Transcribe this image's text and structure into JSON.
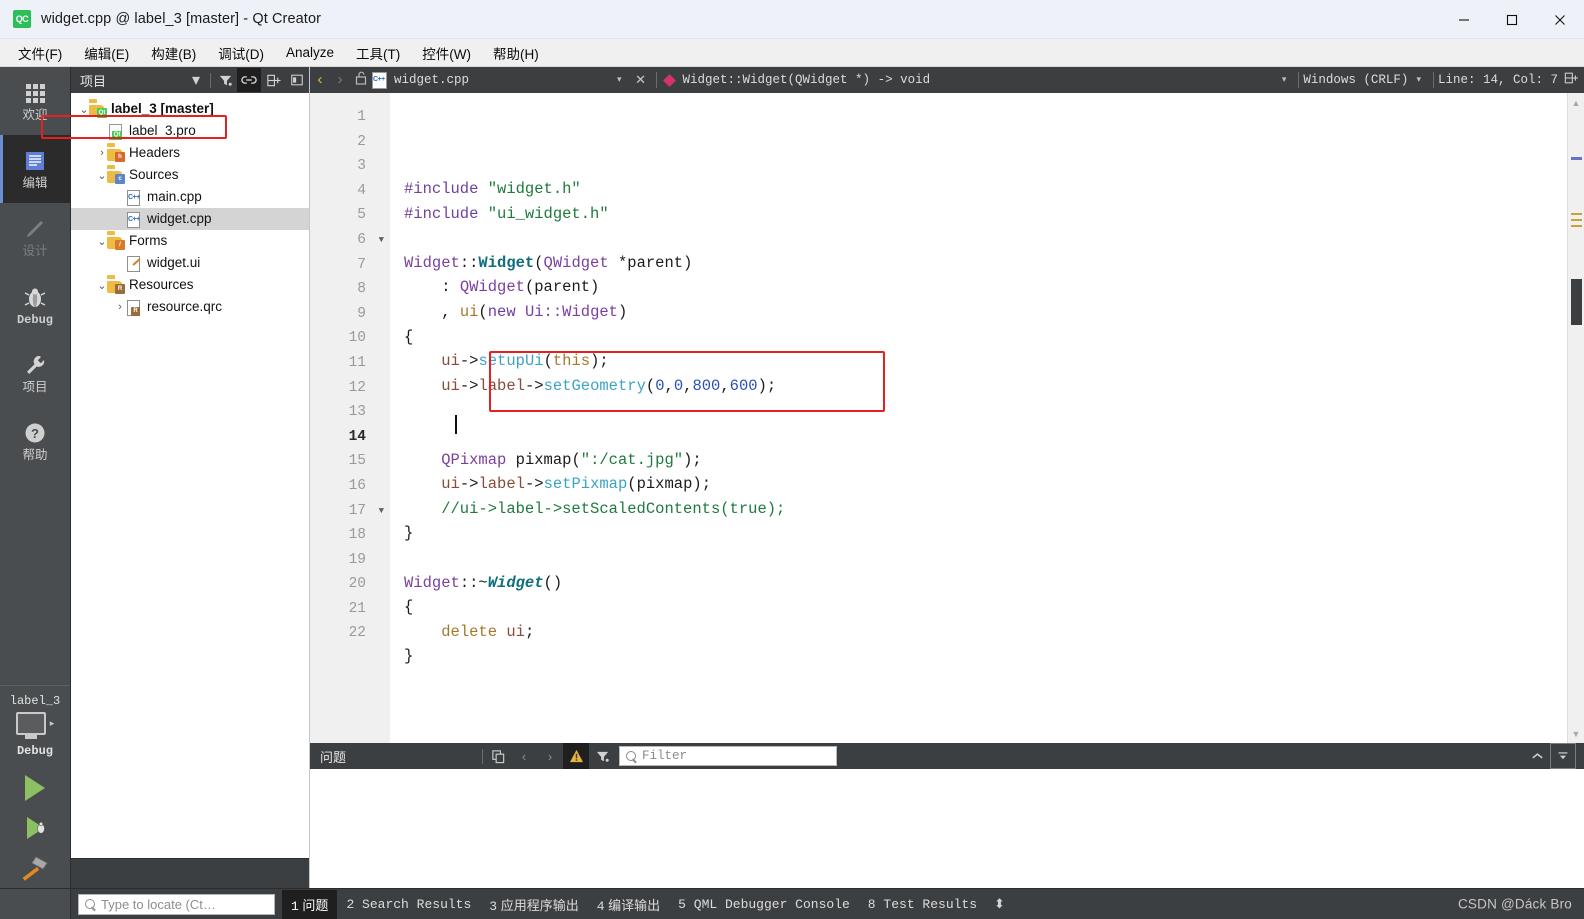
{
  "window": {
    "title": "widget.cpp @ label_3 [master] - Qt Creator",
    "app_icon": "qt-creator-icon",
    "minimize": "─",
    "maximize": "□",
    "close": "✕"
  },
  "menubar": {
    "items": [
      {
        "label": "文件(F)",
        "name": "menu-file"
      },
      {
        "label": "编辑(E)",
        "name": "menu-edit"
      },
      {
        "label": "构建(B)",
        "name": "menu-build"
      },
      {
        "label": "调试(D)",
        "name": "menu-debug"
      },
      {
        "label": "Analyze",
        "name": "menu-analyze"
      },
      {
        "label": "工具(T)",
        "name": "menu-tools"
      },
      {
        "label": "控件(W)",
        "name": "menu-window"
      },
      {
        "label": "帮助(H)",
        "name": "menu-help"
      }
    ]
  },
  "modebar": {
    "modes": [
      {
        "label": "欢迎",
        "icon": "grid-icon",
        "state": "normal"
      },
      {
        "label": "编辑",
        "icon": "document-icon",
        "state": "active"
      },
      {
        "label": "设计",
        "icon": "pencil-icon",
        "state": "disabled"
      },
      {
        "label": "Debug",
        "icon": "bug-icon",
        "state": "normal"
      },
      {
        "label": "项目",
        "icon": "wrench-icon",
        "state": "normal"
      },
      {
        "label": "帮助",
        "icon": "question-icon",
        "state": "normal"
      }
    ],
    "kit": {
      "project": "label_3",
      "build_config": "Debug",
      "selector_icon": "monitor-icon",
      "expand_arrow": "▸"
    },
    "actions": [
      {
        "name": "run-button",
        "icon": "play-icon"
      },
      {
        "name": "debug-button",
        "icon": "play-bug-icon"
      },
      {
        "name": "build-button",
        "icon": "hammer-icon"
      }
    ]
  },
  "project_pane": {
    "header": {
      "title": "项目",
      "dropdown": "▾",
      "buttons": [
        {
          "name": "filter-icon",
          "glyph": "∇"
        },
        {
          "name": "link-with-editor-icon",
          "glyph": "⚭",
          "active": true
        },
        {
          "name": "expand-all-icon",
          "glyph": "⨁"
        },
        {
          "name": "collapse-pane-icon",
          "glyph": "◧"
        }
      ]
    },
    "tree": [
      {
        "label": "label_3 [master]",
        "indent": 0,
        "twisty": "⌄",
        "icon": "folder-qt-icon",
        "bold": true
      },
      {
        "label": "label_3.pro",
        "indent": 1,
        "twisty": "",
        "icon": "file-qt-icon",
        "bold": false
      },
      {
        "label": "Headers",
        "indent": 1,
        "twisty": "›",
        "icon": "folder-h-icon",
        "bold": false
      },
      {
        "label": "Sources",
        "indent": 1,
        "twisty": "⌄",
        "icon": "folder-cpp-icon",
        "bold": false
      },
      {
        "label": "main.cpp",
        "indent": 2,
        "twisty": "",
        "icon": "file-cpp-icon",
        "bold": false
      },
      {
        "label": "widget.cpp",
        "indent": 2,
        "twisty": "",
        "icon": "file-cpp-icon",
        "bold": false,
        "selected": true,
        "highlighted": true
      },
      {
        "label": "Forms",
        "indent": 1,
        "twisty": "⌄",
        "icon": "folder-ui-icon",
        "bold": false
      },
      {
        "label": "widget.ui",
        "indent": 2,
        "twisty": "",
        "icon": "file-ui-icon",
        "bold": false
      },
      {
        "label": "Resources",
        "indent": 1,
        "twisty": "⌄",
        "icon": "folder-res-icon",
        "bold": false
      },
      {
        "label": "resource.qrc",
        "indent": 2,
        "twisty": "›",
        "icon": "file-qrc-icon",
        "bold": false
      }
    ]
  },
  "editor_toolbar": {
    "back_arrow": "‹",
    "forward_arrow": "›",
    "lock_icon": "unlocked-icon",
    "file_icon": "cpp-file-icon",
    "filename": "widget.cpp",
    "file_dropdown": "▾",
    "close_button": "✕",
    "symbol_marker": "function-marker",
    "symbol": "Widget::Widget(QWidget *) -> void",
    "symbol_dropdown": "▾",
    "line_ending": "Windows (CRLF)",
    "line_ending_dropdown": "▾",
    "cursor_position": "Line: 14, Col: 7",
    "split_icon": "split-editor-icon"
  },
  "code": {
    "current_line": 14,
    "total_lines": 22,
    "fold_lines": [
      6,
      17
    ],
    "lines": [
      {
        "n": 1,
        "tokens": [
          {
            "t": "#include ",
            "c": "k-pre"
          },
          {
            "t": "\"widget.h\"",
            "c": "k-str"
          }
        ]
      },
      {
        "n": 2,
        "tokens": [
          {
            "t": "#include ",
            "c": "k-pre"
          },
          {
            "t": "\"ui_widget.h\"",
            "c": "k-str"
          }
        ]
      },
      {
        "n": 3,
        "tokens": []
      },
      {
        "n": 4,
        "tokens": [
          {
            "t": "Widget",
            "c": "k-typ2"
          },
          {
            "t": "::",
            "c": "k-plain"
          },
          {
            "t": "Widget",
            "c": "k-typ"
          },
          {
            "t": "(",
            "c": "k-plain"
          },
          {
            "t": "QWidget",
            "c": "k-typ2"
          },
          {
            "t": " *parent)",
            "c": "k-plain"
          }
        ]
      },
      {
        "n": 5,
        "tokens": [
          {
            "t": "    : ",
            "c": "k-plain"
          },
          {
            "t": "QWidget",
            "c": "k-typ2"
          },
          {
            "t": "(parent)",
            "c": "k-plain"
          }
        ]
      },
      {
        "n": 6,
        "tokens": [
          {
            "t": "    , ",
            "c": "k-plain"
          },
          {
            "t": "ui",
            "c": "k-field"
          },
          {
            "t": "(",
            "c": "k-plain"
          },
          {
            "t": "new",
            "c": "k-kw"
          },
          {
            "t": " ",
            "c": "k-plain"
          },
          {
            "t": "Ui::Widget",
            "c": "k-typ2"
          },
          {
            "t": ")",
            "c": "k-plain"
          }
        ]
      },
      {
        "n": 7,
        "tokens": [
          {
            "t": "{",
            "c": "k-plain"
          }
        ]
      },
      {
        "n": 8,
        "tokens": [
          {
            "t": "    ",
            "c": "k-plain"
          },
          {
            "t": "ui",
            "c": "k-var"
          },
          {
            "t": "->",
            "c": "k-plain"
          },
          {
            "t": "setupUi",
            "c": "k-fn"
          },
          {
            "t": "(",
            "c": "k-plain"
          },
          {
            "t": "this",
            "c": "k-kwthis"
          },
          {
            "t": ");",
            "c": "k-plain"
          }
        ]
      },
      {
        "n": 9,
        "tokens": [
          {
            "t": "    ",
            "c": "k-plain"
          },
          {
            "t": "ui",
            "c": "k-var"
          },
          {
            "t": "->",
            "c": "k-plain"
          },
          {
            "t": "label",
            "c": "k-var"
          },
          {
            "t": "->",
            "c": "k-plain"
          },
          {
            "t": "setGeometry",
            "c": "k-fn"
          },
          {
            "t": "(",
            "c": "k-plain"
          },
          {
            "t": "0",
            "c": "k-num"
          },
          {
            "t": ",",
            "c": "k-plain"
          },
          {
            "t": "0",
            "c": "k-num"
          },
          {
            "t": ",",
            "c": "k-plain"
          },
          {
            "t": "800",
            "c": "k-num"
          },
          {
            "t": ",",
            "c": "k-plain"
          },
          {
            "t": "600",
            "c": "k-num"
          },
          {
            "t": ");",
            "c": "k-plain"
          }
        ]
      },
      {
        "n": 10,
        "tokens": []
      },
      {
        "n": 11,
        "tokens": []
      },
      {
        "n": 12,
        "tokens": [
          {
            "t": "    ",
            "c": "k-plain"
          },
          {
            "t": "QPixmap",
            "c": "k-typ2"
          },
          {
            "t": " pixmap(",
            "c": "k-plain"
          },
          {
            "t": "\":/cat.jpg\"",
            "c": "k-str"
          },
          {
            "t": ");",
            "c": "k-plain"
          }
        ]
      },
      {
        "n": 13,
        "tokens": [
          {
            "t": "    ",
            "c": "k-plain"
          },
          {
            "t": "ui",
            "c": "k-var"
          },
          {
            "t": "->",
            "c": "k-plain"
          },
          {
            "t": "label",
            "c": "k-var"
          },
          {
            "t": "->",
            "c": "k-plain"
          },
          {
            "t": "setPixmap",
            "c": "k-fn"
          },
          {
            "t": "(pixmap);",
            "c": "k-plain"
          }
        ]
      },
      {
        "n": 14,
        "tokens": [
          {
            "t": "    //ui->label->setScaledContents(true);",
            "c": "k-cmt"
          }
        ]
      },
      {
        "n": 15,
        "tokens": [
          {
            "t": "}",
            "c": "k-plain"
          }
        ]
      },
      {
        "n": 16,
        "tokens": []
      },
      {
        "n": 17,
        "tokens": [
          {
            "t": "Widget",
            "c": "k-typ2"
          },
          {
            "t": "::~",
            "c": "k-plain"
          },
          {
            "t": "Widget",
            "c": "k-dtor"
          },
          {
            "t": "()",
            "c": "k-plain"
          }
        ]
      },
      {
        "n": 18,
        "tokens": [
          {
            "t": "{",
            "c": "k-plain"
          }
        ]
      },
      {
        "n": 19,
        "tokens": [
          {
            "t": "    ",
            "c": "k-plain"
          },
          {
            "t": "delete",
            "c": "k-field"
          },
          {
            "t": " ",
            "c": "k-plain"
          },
          {
            "t": "ui",
            "c": "k-var"
          },
          {
            "t": ";",
            "c": "k-plain"
          }
        ]
      },
      {
        "n": 20,
        "tokens": [
          {
            "t": "}",
            "c": "k-plain"
          }
        ]
      },
      {
        "n": 21,
        "tokens": []
      },
      {
        "n": 22,
        "tokens": []
      }
    ],
    "annotation_boxes": [
      {
        "name": "pixmap-code-highlight",
        "color": "#e62020"
      }
    ]
  },
  "output_pane": {
    "title": "问题",
    "buttons": [
      {
        "name": "copy-issues-icon",
        "glyph": "⎘"
      },
      {
        "name": "previous-item-icon",
        "glyph": "‹"
      },
      {
        "name": "next-item-icon",
        "glyph": "›"
      },
      {
        "name": "warning-filter-icon",
        "glyph": "⚠",
        "active": true
      },
      {
        "name": "filter-categories-icon",
        "glyph": "∇"
      }
    ],
    "filter_placeholder": "Filter",
    "right_buttons": [
      {
        "name": "maximize-pane-icon",
        "glyph": "⌃"
      },
      {
        "name": "close-pane-icon",
        "glyph": "▼"
      }
    ]
  },
  "statusbar": {
    "locator_placeholder": "Type to locate (Ct…",
    "tabs": [
      {
        "num": "1",
        "label": "问题",
        "cn": true,
        "active": true
      },
      {
        "num": "2",
        "label": "Search Results",
        "cn": false,
        "active": false
      },
      {
        "num": "3",
        "label": "应用程序输出",
        "cn": true,
        "active": false
      },
      {
        "num": "4",
        "label": "编译输出",
        "cn": true,
        "active": false
      },
      {
        "num": "5",
        "label": "QML Debugger Console",
        "cn": false,
        "active": false
      },
      {
        "num": "8",
        "label": "Test Results",
        "cn": false,
        "active": false
      }
    ],
    "updown": "⬍",
    "watermark": "CSDN @Dáck Bro"
  },
  "colors": {
    "dark_chrome": "#3c3f41",
    "modebar": "#4a4d4f",
    "accent_blue": "#6b8fd4",
    "highlight_red": "#e62020",
    "run_green": "#8dc063",
    "titlebar": "#eef1f8"
  }
}
